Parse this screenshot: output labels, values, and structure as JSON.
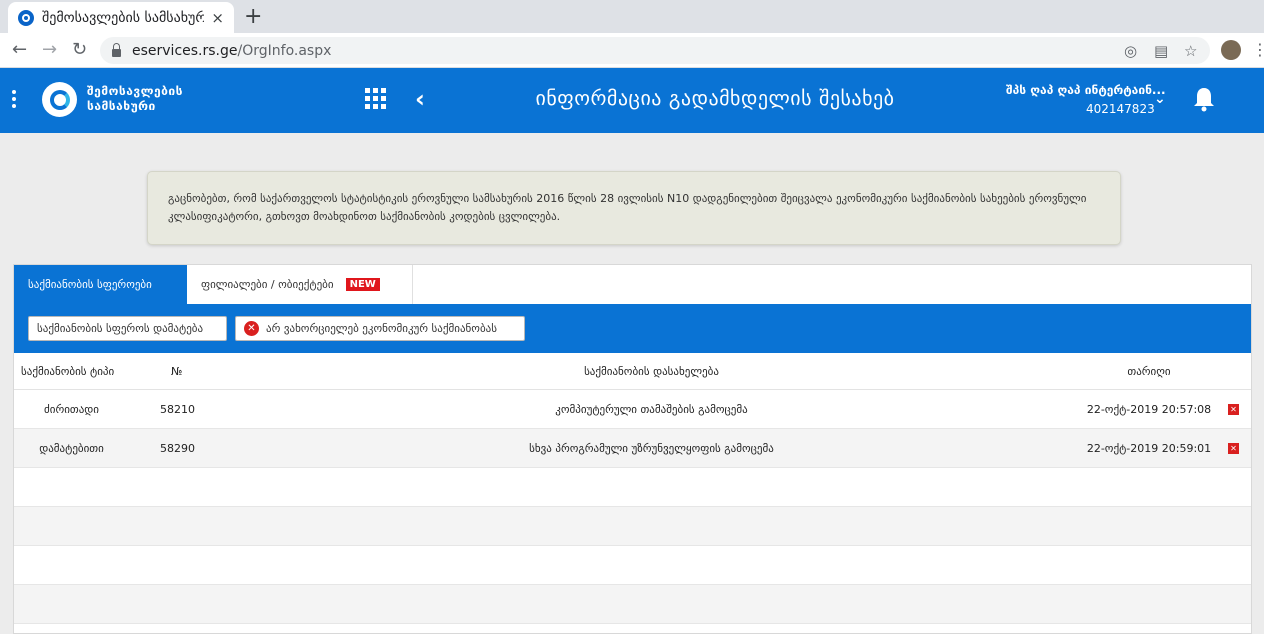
{
  "browser": {
    "tab_title": "შემოსავლების სამსახურ",
    "tab_close": "×",
    "new_tab": "+",
    "url_host": "eservices.rs.ge",
    "url_path": "/OrgInfo.aspx"
  },
  "header": {
    "logo_line1": "შემოსავლების",
    "logo_line2": "სამსახური",
    "title": "ინფორმაცია გადამხდელის შესახებ",
    "user_name": "შპს ღაპ ღაპ ინტერტაინ...",
    "user_id": "402147823"
  },
  "notice": {
    "text": "გაცნობებთ, რომ საქართველოს სტატისტიკის ეროვნული სამსახურის 2016 წლის 28 ივლისის N10 დადგენილებით შეიცვალა ეკონომიკური საქმიანობის სახეების ეროვნული კლასიფიკატორი, გთხოვთ მოახდინოთ საქმიანობის კოდების ცვლილება."
  },
  "tabs": {
    "active": "საქმიანობის სფეროები",
    "inactive": "ფილიალები / ობიექტები",
    "badge": "NEW"
  },
  "toolbar": {
    "add_label": "საქმიანობის სფეროს დამატება",
    "no_activity_label": "არ ვახორციელებ ეკონომიკურ საქმიანობას"
  },
  "table": {
    "headers": {
      "type": "საქმიანობის ტიპი",
      "num": "№",
      "name": "საქმიანობის დასახელება",
      "date": "თარიღი"
    },
    "rows": [
      {
        "type": "ძირითადი",
        "num": "58210",
        "name": "კომპიუტერული თამაშების გამოცემა",
        "date": "22-ოქტ-2019 20:57:08"
      },
      {
        "type": "დამატებითი",
        "num": "58290",
        "name": "სხვა პროგრამული უზრუნველყოფის გამოცემა",
        "date": "22-ოქტ-2019 20:59:01"
      }
    ]
  },
  "colors": {
    "brand_blue": "#0a73d4",
    "danger_red": "#d9201f"
  }
}
